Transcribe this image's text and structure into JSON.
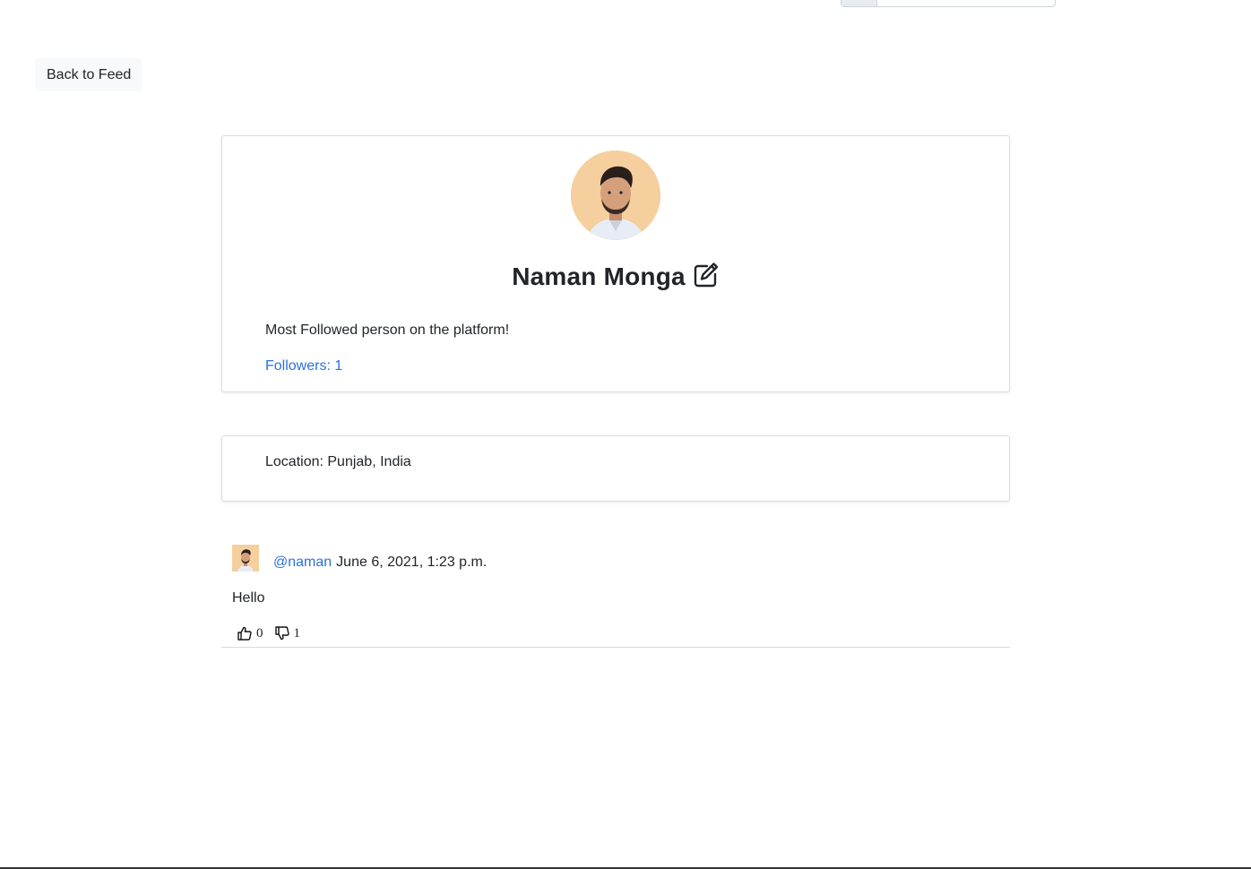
{
  "navigation": {
    "back_label": "Back to Feed"
  },
  "profile": {
    "name": "Naman Monga",
    "bio": "Most Followed person on the platform!",
    "followers_label": "Followers: 1",
    "location_label": "Location: Punjab, India"
  },
  "posts": [
    {
      "author": "@naman",
      "date": "June 6, 2021, 1:23 p.m.",
      "body": "Hello",
      "likes": "0",
      "dislikes": "1"
    }
  ],
  "colors": {
    "link": "#2b72d8",
    "avatar_background": "#f6cf9e",
    "button_background": "#f8f9fa"
  },
  "icons": {
    "edit": "edit-icon",
    "like": "thumbs-up-icon",
    "dislike": "thumbs-down-icon"
  }
}
